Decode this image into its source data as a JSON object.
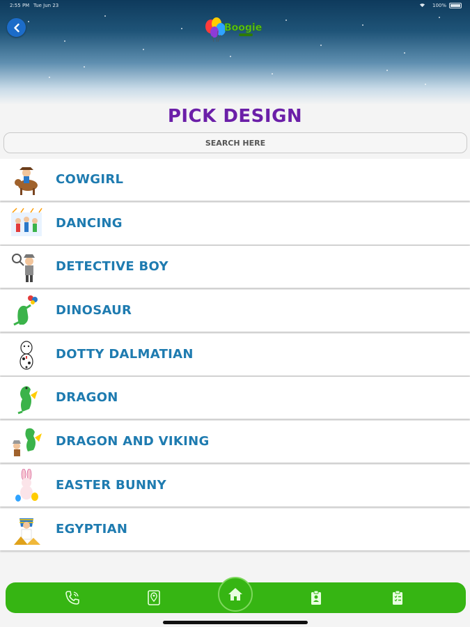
{
  "status_bar": {
    "time": "2:55 PM",
    "date": "Tue Jun 23",
    "battery": "100%"
  },
  "header": {
    "logo_icon": "balloons-logo-icon",
    "logo_text": "Boogie"
  },
  "page": {
    "title": "PICK DESIGN"
  },
  "search": {
    "placeholder": "SEARCH HERE"
  },
  "designs": [
    {
      "label": "COWGIRL",
      "icon": "cowgirl-thumbnail-icon"
    },
    {
      "label": "DANCING",
      "icon": "dancing-thumbnail-icon"
    },
    {
      "label": "DETECTIVE BOY",
      "icon": "detective-boy-thumbnail-icon"
    },
    {
      "label": "DINOSAUR",
      "icon": "dinosaur-thumbnail-icon"
    },
    {
      "label": "DOTTY DALMATIAN",
      "icon": "dalmatian-thumbnail-icon"
    },
    {
      "label": "DRAGON",
      "icon": "dragon-thumbnail-icon"
    },
    {
      "label": "DRAGON AND VIKING",
      "icon": "dragon-viking-thumbnail-icon"
    },
    {
      "label": "EASTER BUNNY",
      "icon": "easter-bunny-thumbnail-icon"
    },
    {
      "label": "EGYPTIAN",
      "icon": "egyptian-thumbnail-icon"
    }
  ],
  "bottom_nav": {
    "items": [
      "phone-icon",
      "location-icon",
      "home-icon",
      "badge-icon",
      "checklist-icon"
    ]
  },
  "colors": {
    "title_purple": "#6b1fa8",
    "label_blue": "#1e7bb0",
    "nav_green": "#36b513",
    "back_blue": "#1c6cc9"
  }
}
